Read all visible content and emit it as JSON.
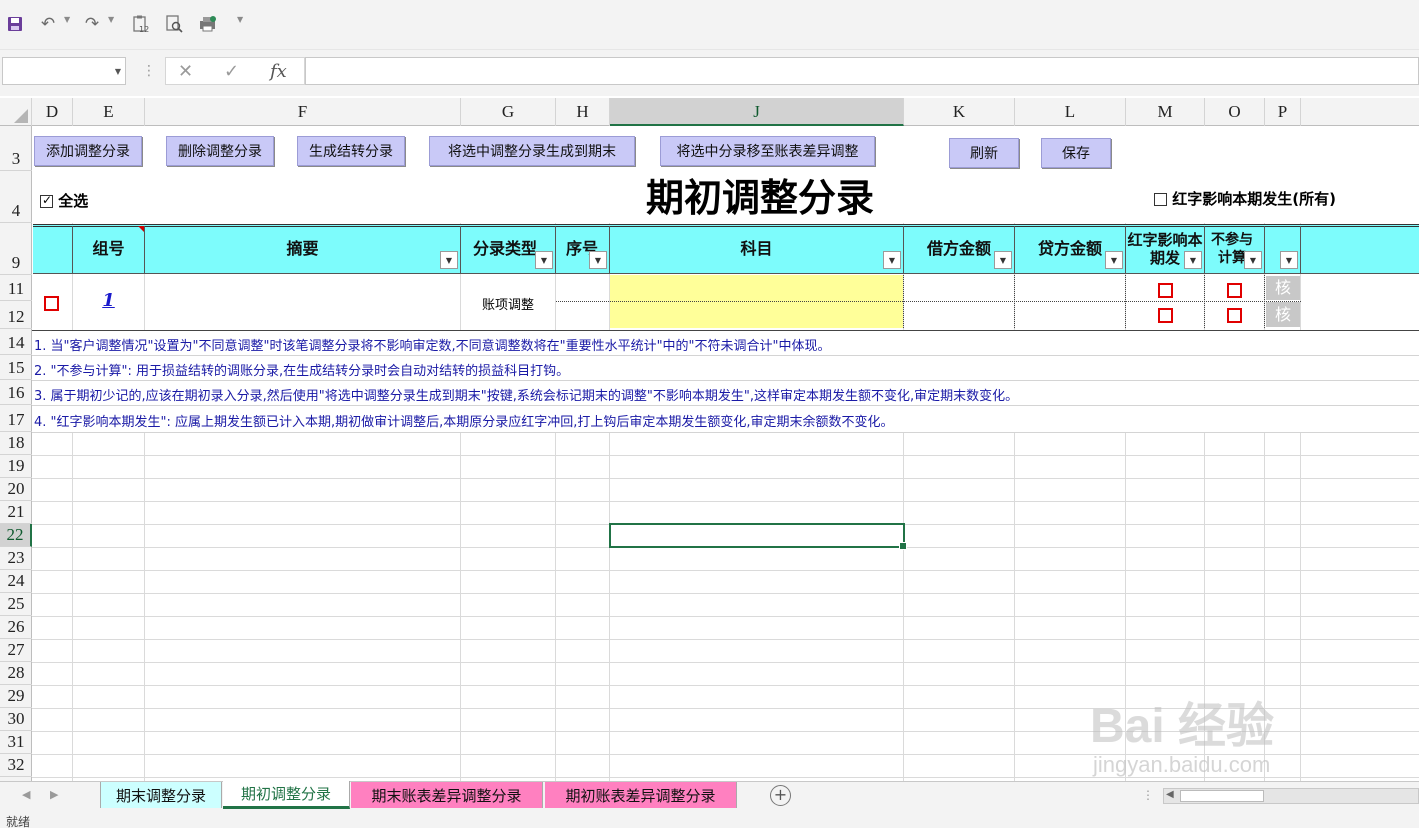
{
  "qat": {
    "save_icon": "save-icon",
    "undo_icon": "undo-icon",
    "redo_icon": "redo-icon",
    "clipboard_badge": "12"
  },
  "formula_bar": {
    "name_box": "",
    "formula": "",
    "fx_label": "fx"
  },
  "columns": [
    "D",
    "E",
    "F",
    "G",
    "H",
    "J",
    "K",
    "L",
    "M",
    "O",
    "P"
  ],
  "selected_column": "J",
  "rows": [
    "3",
    "4",
    "9",
    "11",
    "12",
    "14",
    "15",
    "16",
    "17",
    "18",
    "19",
    "20",
    "21",
    "22",
    "23",
    "24",
    "25",
    "26",
    "27",
    "28",
    "29",
    "30",
    "31",
    "32"
  ],
  "selected_row": "22",
  "buttons": {
    "add": "添加调整分录",
    "delete": "删除调整分录",
    "generate_carry": "生成结转分录",
    "to_period_end": "将选中调整分录生成到期末",
    "to_diff": "将选中分录移至账表差异调整",
    "refresh": "刷新",
    "save": "保存"
  },
  "title": "期初调整分录",
  "select_all": {
    "label": "全选",
    "checked": true
  },
  "red_affect_all": {
    "label": "红字影响本期发生(所有)",
    "checked": false
  },
  "table": {
    "headers": {
      "group": "组号",
      "summary": "摘要",
      "entry_type": "分录类型",
      "seq": "序号",
      "account": "科目",
      "debit": "借方金额",
      "credit": "贷方金额",
      "red_affect": "红字影响本期发",
      "not_in_calc": "不参与计算",
      "p": ""
    },
    "row": {
      "group": "1",
      "entry_type": "账项调整",
      "check1": "核",
      "check2": "核"
    }
  },
  "notes": [
    "1. 当\"客户调整情况\"设置为\"不同意调整\"时该笔调整分录将不影响审定数,不同意调整数将在\"重要性水平统计\"中的\"不符未调合计\"中体现。",
    "2. \"不参与计算\": 用于损益结转的调账分录,在生成结转分录时会自动对结转的损益科目打钩。",
    "3. 属于期初少记的,应该在期初录入分录,然后使用\"将选中调整分录生成到期末\"按键,系统会标记期末的调整\"不影响本期发生\",这样审定本期发生额不变化,审定期末数变化。",
    "4. \"红字影响本期发生\": 应属上期发生额已计入本期,期初做审计调整后,本期原分录应红字冲回,打上钩后审定本期发生额变化,审定期末余额数不变化。"
  ],
  "tabs": [
    {
      "label": "期末调整分录",
      "color": "#ccffff",
      "active": false
    },
    {
      "label": "期初调整分录",
      "color": "#ffffff",
      "active": true
    },
    {
      "label": "期末账表差异调整分录",
      "color": "#ff80c0",
      "active": false
    },
    {
      "label": "期初账表差异调整分录",
      "color": "#ff80c0",
      "active": false
    }
  ],
  "status": "就绪",
  "watermark": {
    "main": "Bai 经验",
    "sub": "jingyan.baidu.com"
  },
  "colors": {
    "header_band": "#7dfcfc",
    "button": "#c9c9f7",
    "accent": "#217346",
    "note_text": "#1a1aa6"
  }
}
